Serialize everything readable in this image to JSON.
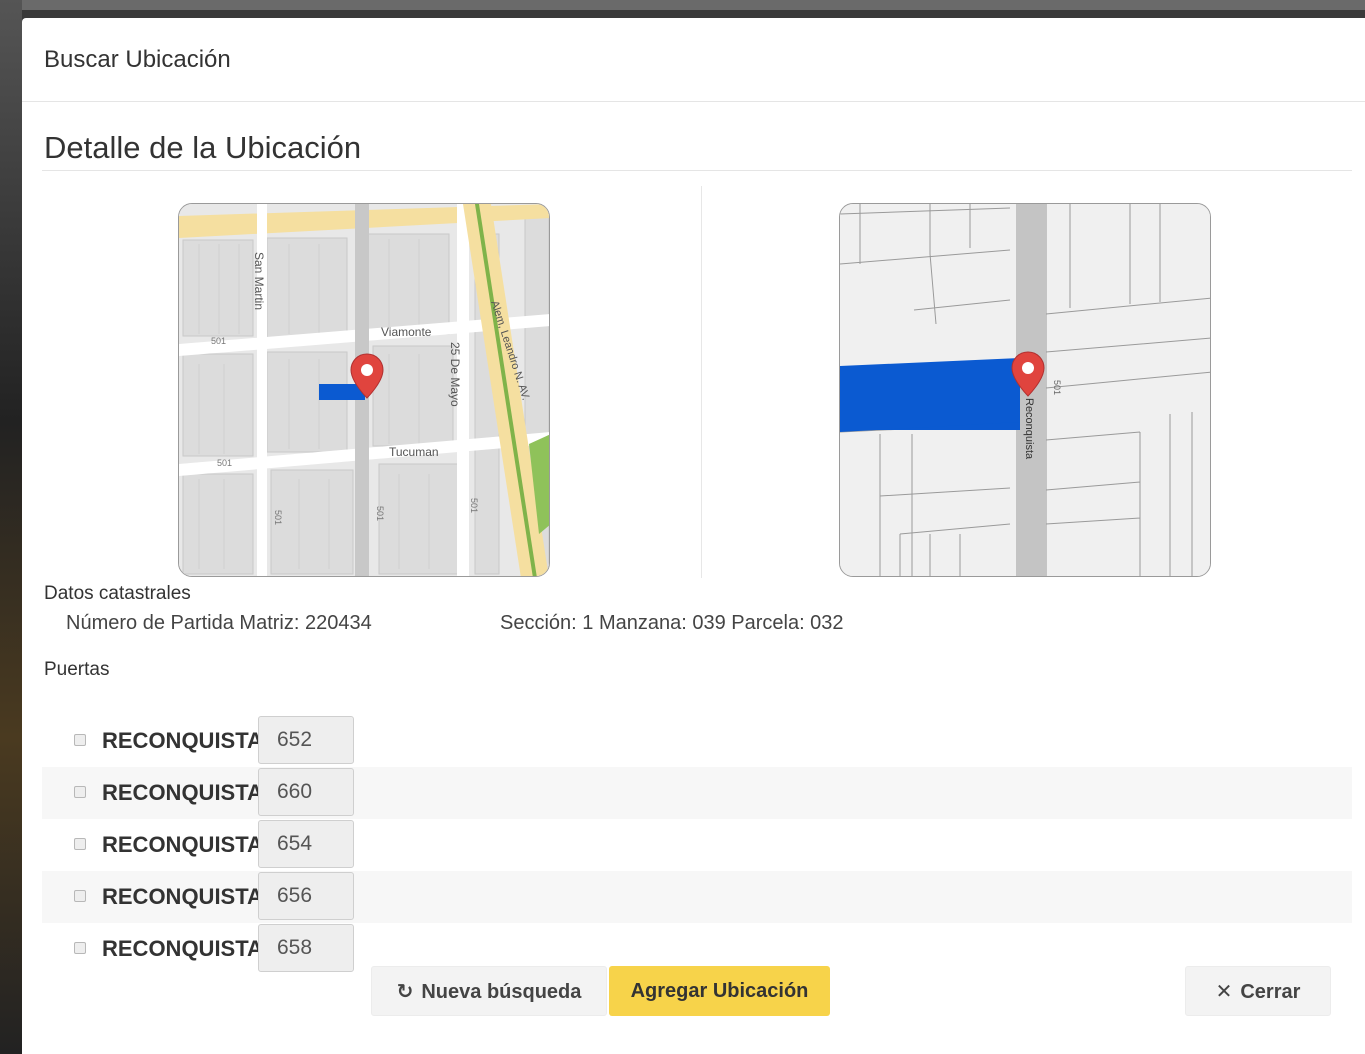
{
  "dialog": {
    "title": "Buscar Ubicación",
    "section_title": "Detalle de la Ubicación"
  },
  "maps": {
    "overview": {
      "streets": [
        "San Martin",
        "Viamonte",
        "25 De Mayo",
        "Alem, Leandro N. AV.",
        "Tucuman"
      ],
      "street_codes": [
        "501",
        "501",
        "501",
        "501",
        "501"
      ],
      "pin_color": "#e0443e",
      "highlight_color": "#0b5ad1"
    },
    "detail": {
      "street": "Reconquista",
      "code": "501",
      "pin_color": "#e0443e",
      "highlight_color": "#0b5ad1"
    }
  },
  "cadastral": {
    "heading": "Datos catastrales",
    "partida": "Número de Partida Matriz: 220434",
    "seccion": "Sección: 1 Manzana: 039 Parcela: 032"
  },
  "doors": {
    "heading": "Puertas",
    "items": [
      {
        "street": "RECONQUISTA",
        "number": "652"
      },
      {
        "street": "RECONQUISTA",
        "number": "660"
      },
      {
        "street": "RECONQUISTA",
        "number": "654"
      },
      {
        "street": "RECONQUISTA",
        "number": "656"
      },
      {
        "street": "RECONQUISTA",
        "number": "658"
      }
    ]
  },
  "actions": {
    "nueva_busqueda": "Nueva búsqueda",
    "agregar": "Agregar Ubicación",
    "cerrar": "Cerrar"
  },
  "colors": {
    "accent": "#f7d34a"
  }
}
